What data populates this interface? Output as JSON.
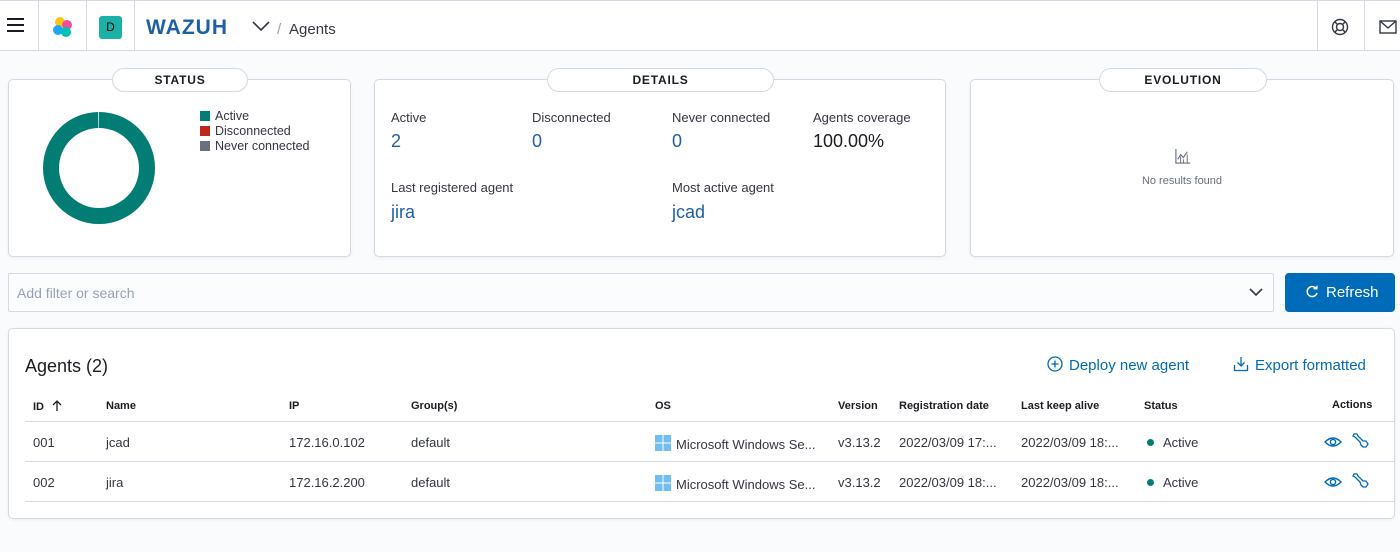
{
  "header": {
    "brand": "WAZUH",
    "space_initial": "D",
    "breadcrumb_slash": "/",
    "breadcrumb_current": "Agents"
  },
  "status_panel": {
    "title": "STATUS",
    "legend": [
      {
        "label": "Active",
        "color": "#017d73"
      },
      {
        "label": "Disconnected",
        "color": "#bd271e"
      },
      {
        "label": "Never connected",
        "color": "#69707d"
      }
    ],
    "donut": {
      "active": 2,
      "disconnected": 0,
      "never_connected": 0
    }
  },
  "details_panel": {
    "title": "DETAILS",
    "active_label": "Active",
    "active_value": "2",
    "disconnected_label": "Disconnected",
    "disconnected_value": "0",
    "never_label": "Never connected",
    "never_value": "0",
    "coverage_label": "Agents coverage",
    "coverage_value": "100.00%",
    "last_registered_label": "Last registered agent",
    "last_registered_value": "jira",
    "most_active_label": "Most active agent",
    "most_active_value": "jcad"
  },
  "evolution_panel": {
    "title": "EVOLUTION",
    "empty_text": "No results found"
  },
  "search": {
    "placeholder": "Add filter or search",
    "value": ""
  },
  "refresh_label": "Refresh",
  "agents_table": {
    "title": "Agents (2)",
    "deploy_label": "Deploy new agent",
    "export_label": "Export formatted",
    "columns": {
      "id": "ID",
      "name": "Name",
      "ip": "IP",
      "groups": "Group(s)",
      "os": "OS",
      "version": "Version",
      "registration": "Registration date",
      "keepalive": "Last keep alive",
      "status": "Status",
      "actions": "Actions"
    },
    "rows": [
      {
        "id": "001",
        "name": "jcad",
        "ip": "172.16.0.102",
        "group": "default",
        "os": "Microsoft Windows Se...",
        "version": "v3.13.2",
        "registration": "2022/03/09 17:...",
        "keepalive": "2022/03/09 18:...",
        "status": "Active"
      },
      {
        "id": "002",
        "name": "jira",
        "ip": "172.16.2.200",
        "group": "default",
        "os": "Microsoft Windows Se...",
        "version": "v3.13.2",
        "registration": "2022/03/09 18:...",
        "keepalive": "2022/03/09 18:...",
        "status": "Active"
      }
    ]
  },
  "colors": {
    "accent": "#006bb8",
    "brand": "#1f5fa8",
    "active": "#017d73"
  }
}
